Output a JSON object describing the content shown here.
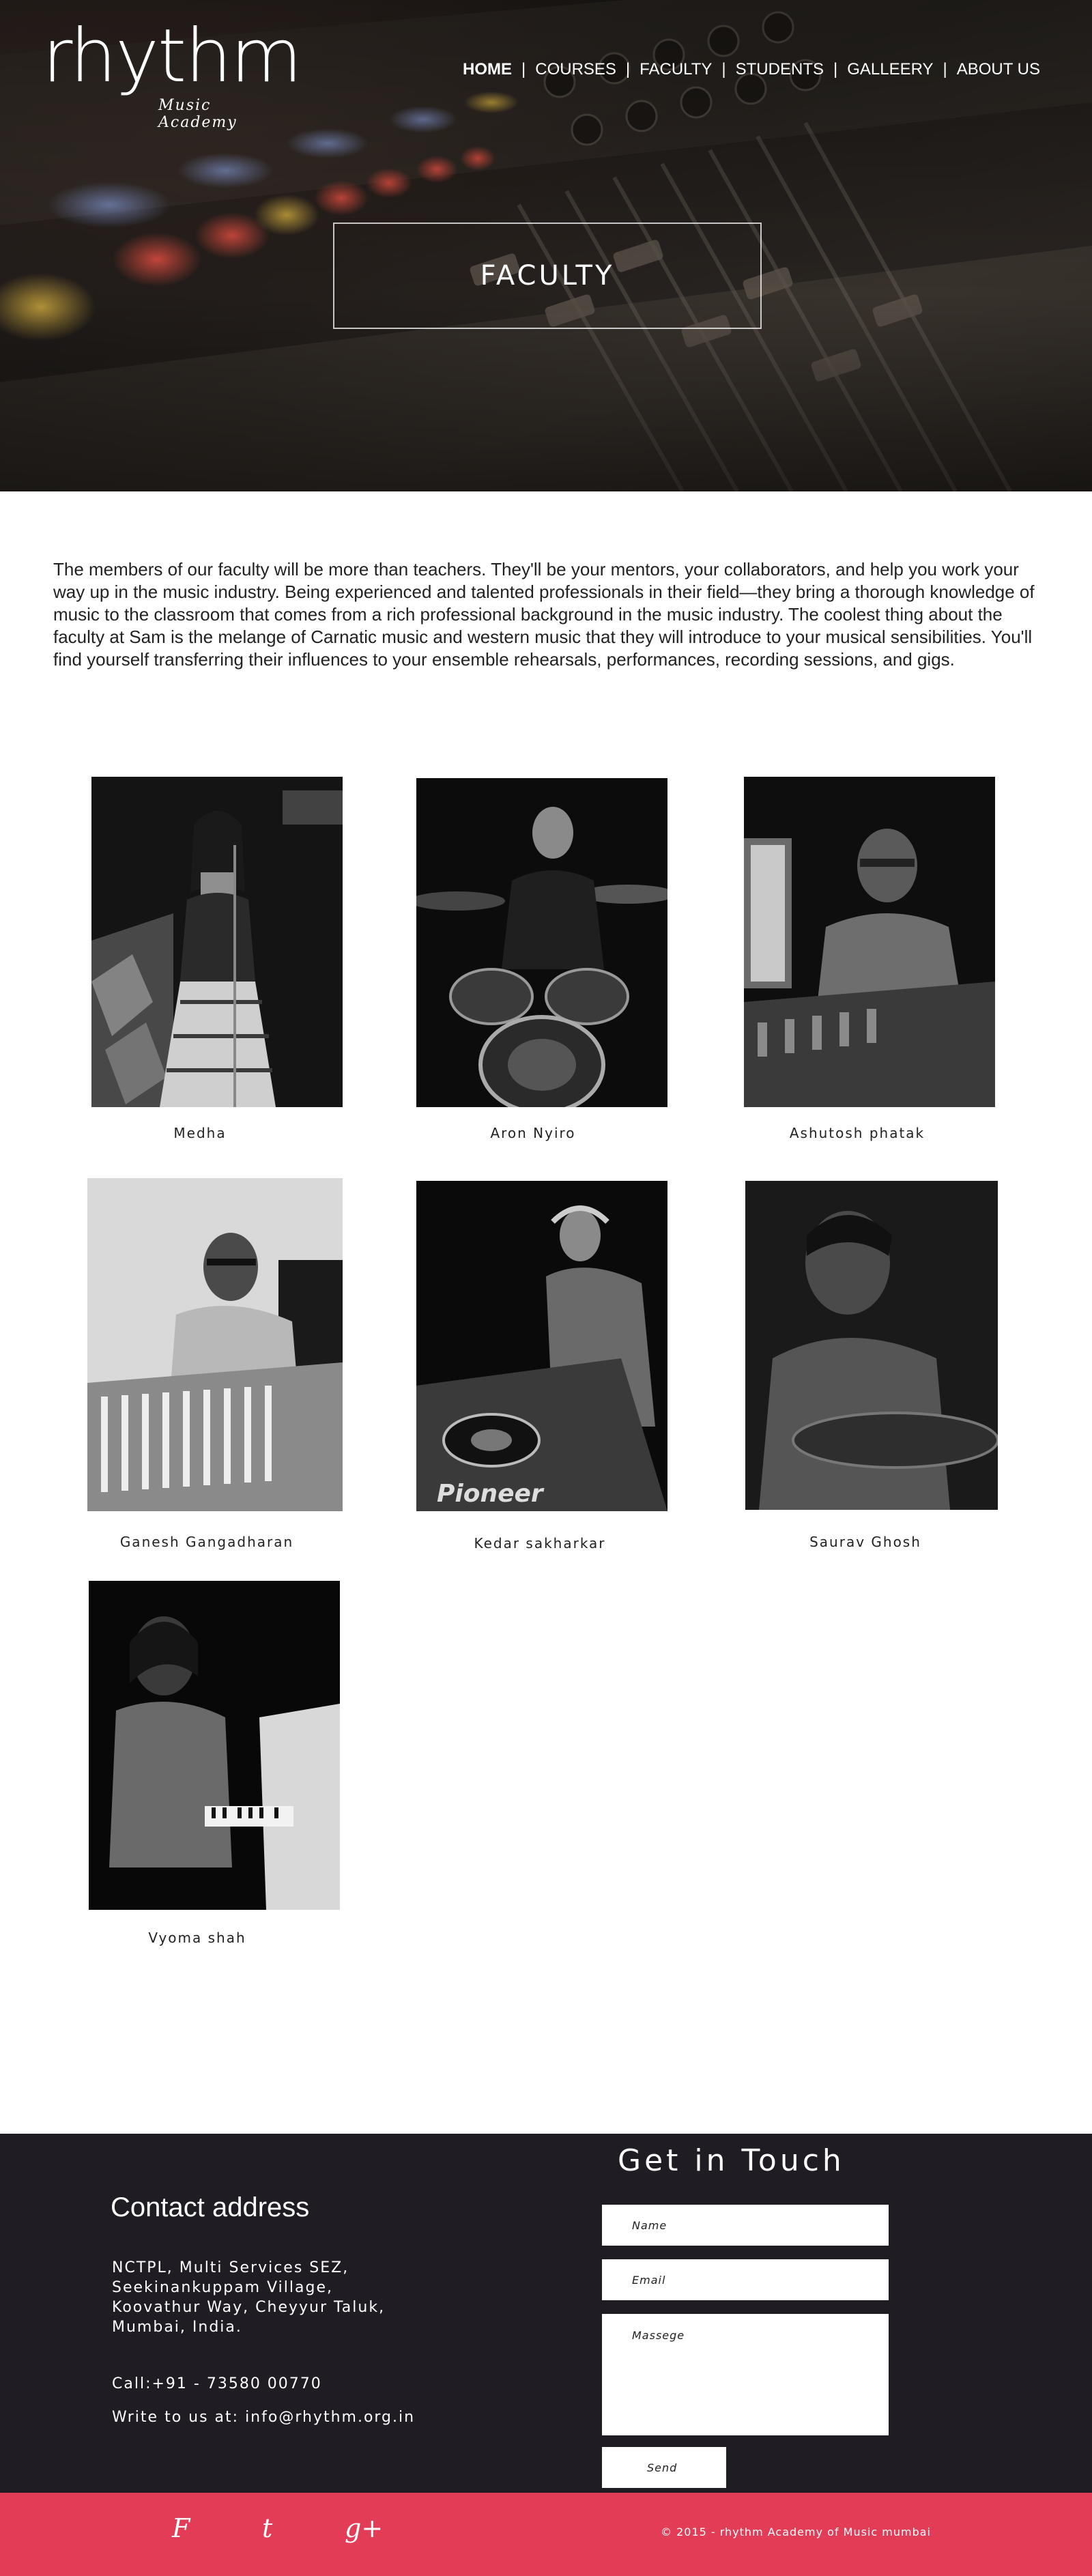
{
  "logo": {
    "word": "rhythm",
    "sub": "Music Academy"
  },
  "nav": {
    "items": [
      {
        "label": "HOME"
      },
      {
        "label": "COURSES"
      },
      {
        "label": "FACULTY"
      },
      {
        "label": "STUDENTS"
      },
      {
        "label": "GALLEERY"
      },
      {
        "label": "ABOUT US"
      }
    ],
    "separator": "|"
  },
  "hero": {
    "title": "FACULTY"
  },
  "intro": {
    "text": "The members of our faculty will be more than teachers. They'll be your mentors, your collaborators, and help you work your way up in the music industry. Being experienced and talented professionals in their field—they bring a thorough knowledge of music to the classroom that comes from a rich professional background in the music industry. The coolest thing about the faculty at Sam is the melange of Carnatic music and western music that they will introduce to your musical sensibilities. You'll find yourself transferring their influences to your ensemble rehearsals, performances, recording sessions, and gigs."
  },
  "faculty": [
    {
      "name": "Medha"
    },
    {
      "name": "Aron Nyiro"
    },
    {
      "name": "Ashutosh phatak"
    },
    {
      "name": "Ganesh Gangadharan"
    },
    {
      "name": "Kedar sakharkar"
    },
    {
      "name": "Saurav Ghosh"
    },
    {
      "name": "Vyoma shah"
    }
  ],
  "contact": {
    "title": "Contact address",
    "address": "NCTPL, Multi Services SEZ, Seekinankuppam Village, Koovathur Way, Cheyyur Taluk, Mumbai, India.",
    "phone": "Call:+91 - 73580 00770",
    "email": "Write to us at: info@rhythm.org.in"
  },
  "form": {
    "title": "Get in Touch",
    "name_placeholder": "Name",
    "email_placeholder": "Email",
    "message_placeholder": "Massege",
    "send_label": "Send"
  },
  "social": {
    "facebook": "F",
    "twitter": "t",
    "google": "g+"
  },
  "copyright": "© 2015 - rhythm Academy of Music mumbai",
  "colors": {
    "footer": "#1f1d23",
    "bottom_bar": "#e23c57",
    "text": "#222222"
  }
}
